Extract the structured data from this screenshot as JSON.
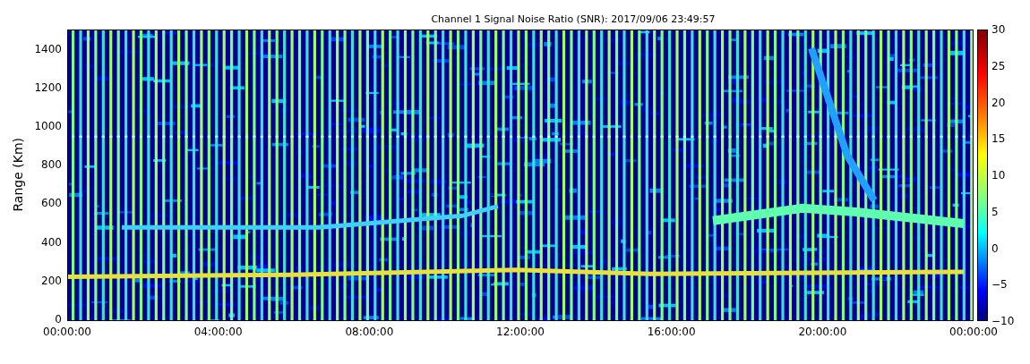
{
  "title": "Channel 1 Signal Noise Ratio (SNR): 2017/09/06 23:49:57",
  "ylabel": "Range (Km)",
  "yticks": [
    "1400",
    "1200",
    "1000",
    "800",
    "600",
    "400",
    "200",
    "0"
  ],
  "xticks": [
    "00:00:00",
    "04:00:00",
    "08:00:00",
    "12:00:00",
    "16:00:00",
    "20:00:00",
    "00:00:00"
  ],
  "colorbar": {
    "ticks": [
      "30",
      "25",
      "20",
      "15",
      "10",
      "5",
      "0",
      "−5",
      "−10"
    ]
  }
}
